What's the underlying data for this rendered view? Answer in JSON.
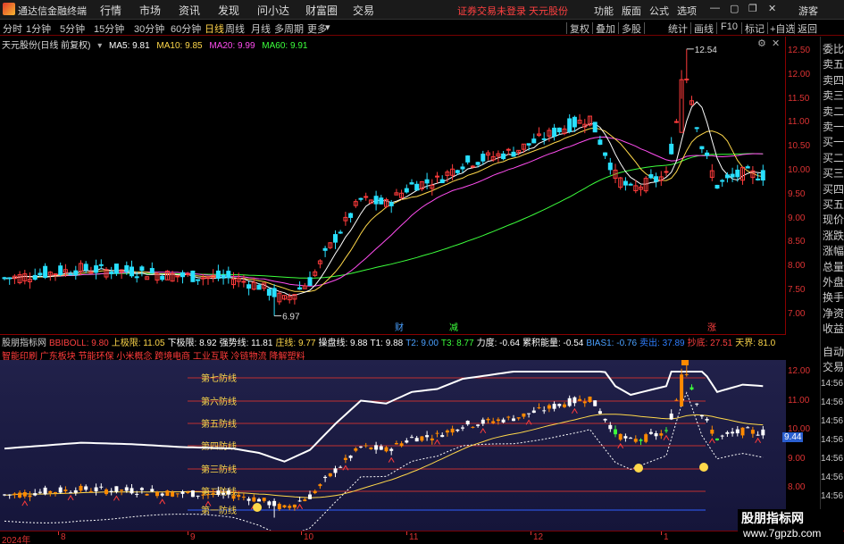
{
  "app": {
    "title": "通达信金融终端",
    "menu": [
      "行情",
      "市场",
      "资讯",
      "发现",
      "问小达",
      "财富圈",
      "交易"
    ],
    "notice": "证券交易未登录  天元股份",
    "right_menu": [
      "功能",
      "版面",
      "公式",
      "选项"
    ],
    "guest": "游客"
  },
  "periods": [
    "分时",
    "1分钟",
    "5分钟",
    "15分钟",
    "30分钟",
    "60分钟",
    "日线",
    "周线",
    "月线",
    "多周期",
    "更多"
  ],
  "active_period": "日线",
  "toolbar": [
    "复权",
    "叠加",
    "多股",
    "统计",
    "画线",
    "F10",
    "标记",
    "+自选",
    "返回"
  ],
  "main": {
    "stock_label": "天元股份(日线 前复权)",
    "ma": [
      {
        "label": "MA5: 9.81",
        "color": "#ffffff"
      },
      {
        "label": "MA10: 9.85",
        "color": "#ffd84a"
      },
      {
        "label": "MA20: 9.99",
        "color": "#ff4df0"
      },
      {
        "label": "MA60: 9.91",
        "color": "#3cff3c"
      }
    ],
    "high_label": "12.54",
    "low_label": "6.97",
    "markers": [
      {
        "text": "财",
        "color": "#4aa0ff"
      },
      {
        "text": "减",
        "color": "#3cff3c"
      },
      {
        "text": "涨",
        "color": "#ff4040"
      }
    ],
    "y_ticks": [
      "12.50",
      "12.00",
      "11.50",
      "11.00",
      "10.50",
      "10.00",
      "9.50",
      "9.00",
      "8.50",
      "8.00",
      "7.50",
      "7.00"
    ]
  },
  "sub": {
    "legend": [
      {
        "text": "股朋指标网",
        "color": "#cccccc"
      },
      {
        "text": "BBIBOLL: 9.80",
        "color": "#ff4040"
      },
      {
        "text": "上极限: 11.05",
        "color": "#ffd84a"
      },
      {
        "text": "下极限: 8.92",
        "color": "#ffffff"
      },
      {
        "text": "强势线: 11.81",
        "color": "#ffffff"
      },
      {
        "text": "庄线: 9.77",
        "color": "#ffd84a"
      },
      {
        "text": "操盘线: 9.88",
        "color": "#ffffff"
      },
      {
        "text": "T1: 9.88",
        "color": "#ffffff"
      },
      {
        "text": "T2: 9.00",
        "color": "#4aa0ff"
      },
      {
        "text": "T3: 8.77",
        "color": "#3cff3c"
      },
      {
        "text": "力度: -0.64",
        "color": "#ffffff"
      },
      {
        "text": "累积能量: -0.54",
        "color": "#ffffff"
      },
      {
        "text": "BIAS1: -0.76",
        "color": "#4aa0ff"
      },
      {
        "text": "卖出: 37.89",
        "color": "#2f7fff"
      },
      {
        "text": "抄底: 27.51",
        "color": "#ff4040"
      },
      {
        "text": "天界: 81.0",
        "color": "#ffd84a"
      }
    ],
    "concepts": "智能印刷 广东板块 节能环保 小米概念 跨境电商 工业互联 冷链物流 降解塑料",
    "defense_lines": [
      "第七防线",
      "第六防线",
      "第五防线",
      "第四防线",
      "第三防线",
      "第二防线",
      "第一防线"
    ],
    "y_ticks": [
      "12.00",
      "11.00",
      "10.00",
      "9.00",
      "8.00"
    ],
    "current_price": "9.44"
  },
  "quote_labels": [
    "委比",
    "卖五",
    "卖四",
    "卖三",
    "卖二",
    "卖一",
    "买一",
    "买二",
    "买三",
    "买四",
    "买五",
    "现价",
    "涨跌",
    "涨幅",
    "总量",
    "外盘",
    "换手",
    "净资",
    "收益"
  ],
  "quote_labels2": [
    "自动",
    "交易"
  ],
  "times": [
    "14:56",
    "14:56",
    "14:56",
    "14:56",
    "14:56",
    "14:56",
    "14:56",
    "14:56"
  ],
  "date_ticks": [
    "2024年",
    "8",
    "9",
    "10",
    "11",
    "12",
    "1"
  ],
  "watermark": {
    "title": "股朋指标网",
    "url": "www.7gpzb.com"
  },
  "colors": {
    "up": "#ff3b3b",
    "down": "#29e0ff",
    "ma60": "#3cff3c",
    "ma20": "#ff4df0",
    "ma10": "#ffd84a",
    "ma5": "#ffffff",
    "axis": "#dd3333"
  }
}
